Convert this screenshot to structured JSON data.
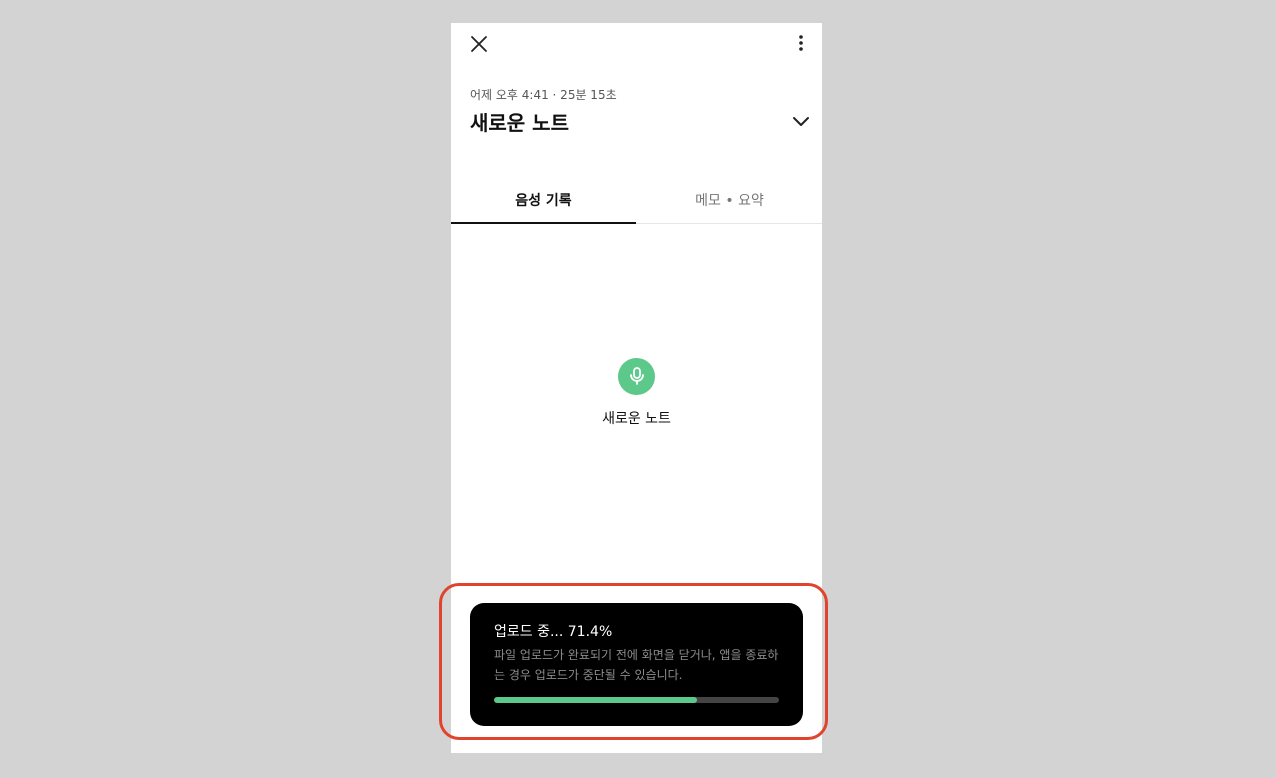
{
  "header": {
    "meta": "어제 오후 4:41 · 25분 15초",
    "title": "새로운 노트"
  },
  "icons": {
    "close": "close-icon",
    "more": "more-vertical-icon",
    "expand": "chevron-down-icon",
    "mic": "microphone-icon"
  },
  "tabs": [
    {
      "label": "음성 기록",
      "active": true
    },
    {
      "label": "메모 • 요약",
      "active": false
    }
  ],
  "empty_state": {
    "label": "새로운 노트"
  },
  "upload_toast": {
    "title": "업로드 중... 71.4%",
    "message": "파일 업로드가 완료되기 전에 화면을 닫거나, 앱을 종료하는 경우 업로드가 중단될 수 있습니다.",
    "progress": 71.4
  },
  "colors": {
    "accent": "#5cc98a",
    "highlight": "#e0442e",
    "toast_bg": "#000000"
  }
}
